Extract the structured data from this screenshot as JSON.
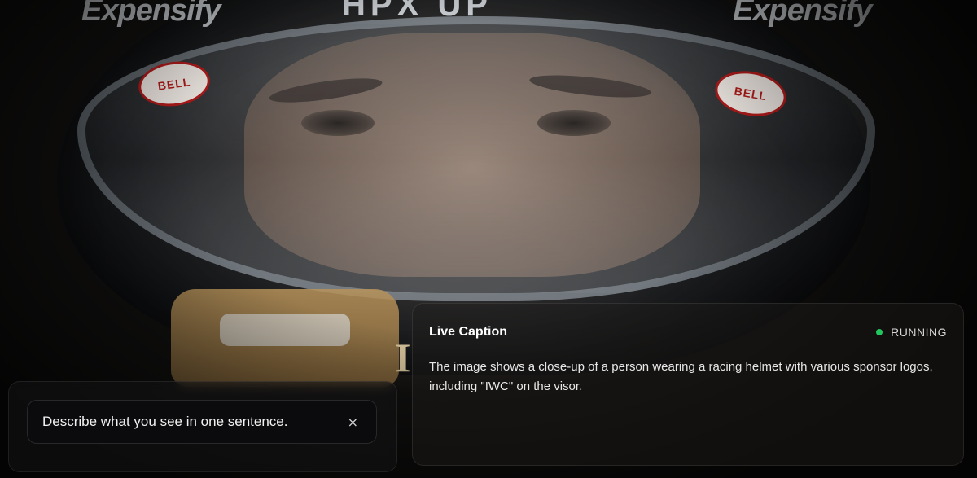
{
  "scene": {
    "helmet_sponsor_left": "Expensify",
    "helmet_sponsor_right": "Expensify",
    "helmet_logo_center": "HPX UP",
    "bell_left": "BELL",
    "bell_right": "BELL",
    "chin_letter": "I"
  },
  "prompt": {
    "value": "Describe what you see in one sentence.",
    "clear_icon": "×"
  },
  "caption": {
    "title": "Live Caption",
    "status": "RUNNING",
    "status_color": "#22c55e",
    "text": "The image shows a close-up of a person wearing a racing helmet with various sponsor logos, including \"IWC\" on the visor."
  }
}
